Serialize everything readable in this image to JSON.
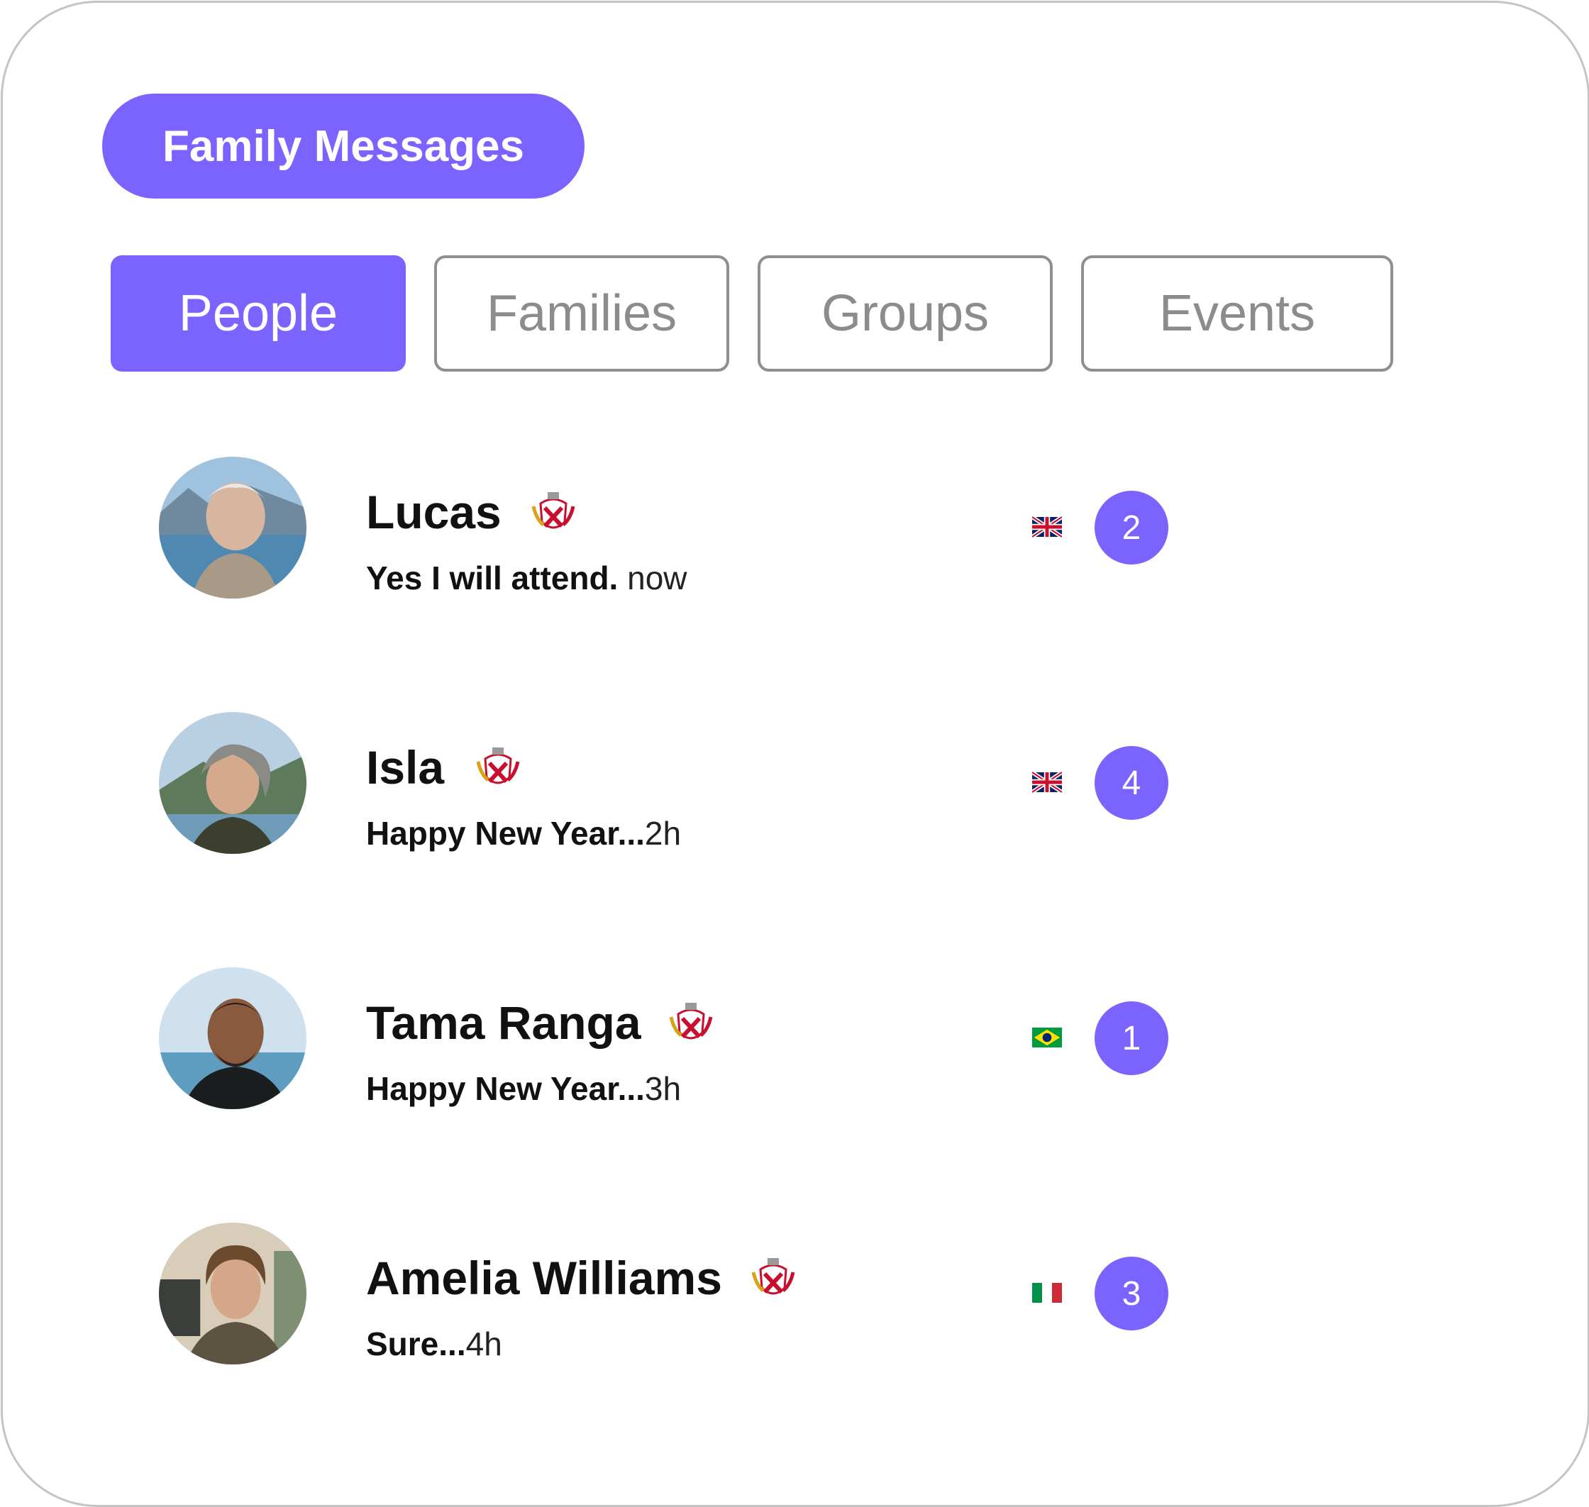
{
  "header": {
    "title": "Family Messages"
  },
  "tabs": [
    {
      "label": "People",
      "active": true
    },
    {
      "label": "Families",
      "active": false
    },
    {
      "label": "Groups",
      "active": false
    },
    {
      "label": "Events",
      "active": false
    }
  ],
  "conversations": [
    {
      "name": "Lucas",
      "message": "Yes I will attend.",
      "time": " now",
      "flag": "uk-flag-icon",
      "unread": "2"
    },
    {
      "name": "Isla",
      "message": "Happy New Year...",
      "time": "2h",
      "flag": "uk-flag-icon",
      "unread": "4"
    },
    {
      "name": "Tama Ranga",
      "message": "Happy New Year...",
      "time": "3h",
      "flag": "brazil-flag-icon",
      "unread": "1"
    },
    {
      "name": "Amelia Williams",
      "message": "Sure...",
      "time": "4h",
      "flag": "italy-flag-icon",
      "unread": "3"
    }
  ],
  "icons": {
    "crest": "family-crest-icon",
    "avatar": "avatar"
  },
  "colors": {
    "accent": "#7a63ff",
    "tab_border": "#8f8f8f",
    "card_border": "#c4c4c4"
  }
}
